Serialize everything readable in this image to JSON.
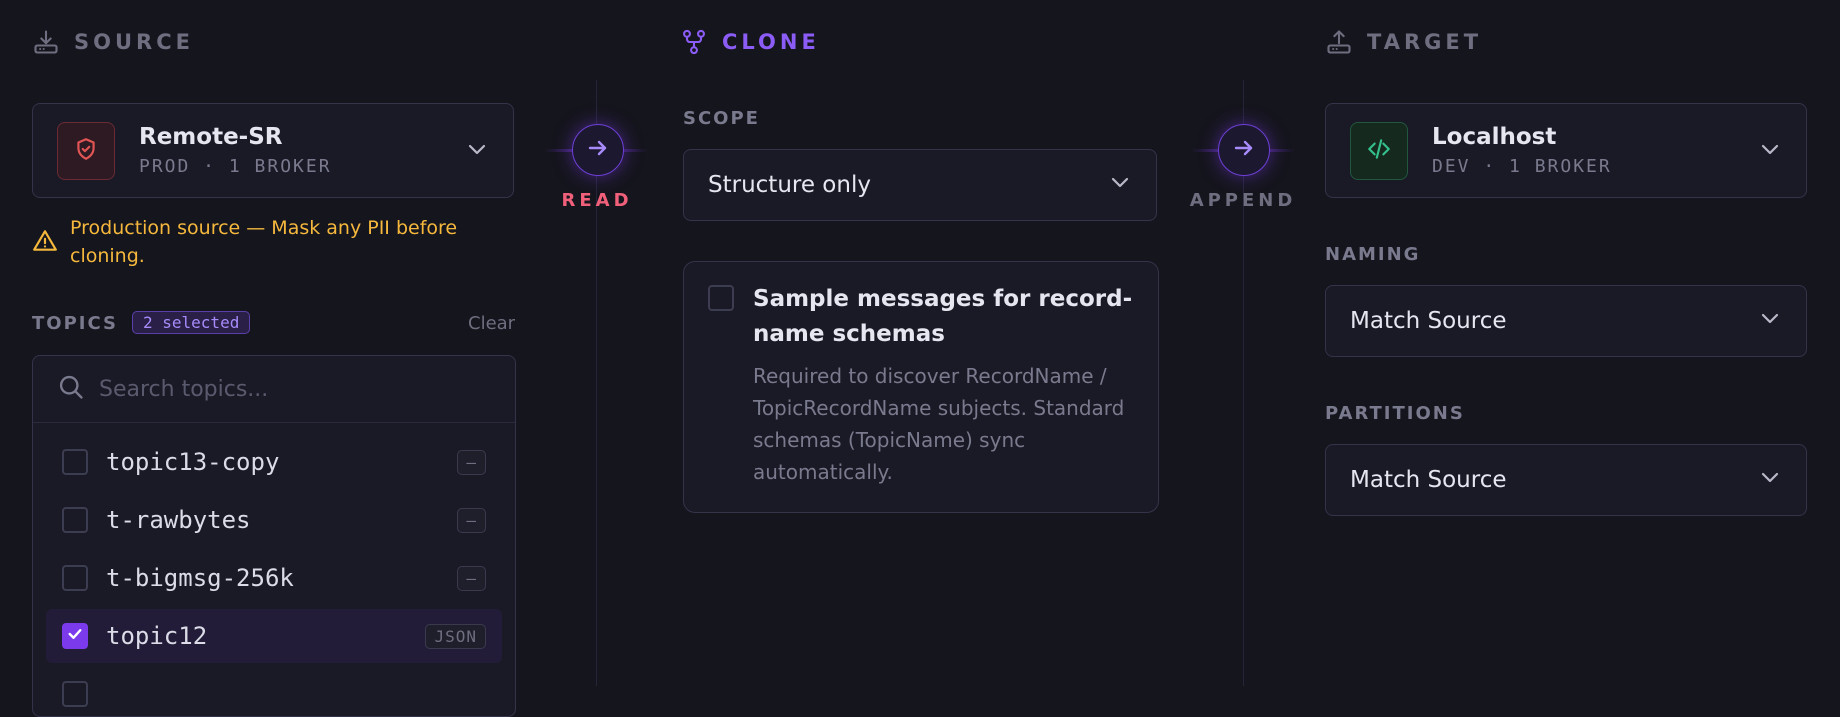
{
  "source": {
    "title": "SOURCE",
    "selected": {
      "name": "Remote-SR",
      "meta": "PROD · 1 BROKER"
    },
    "warning": "Production source — Mask any PII before cloning.",
    "topics_label": "TOPICS",
    "selected_badge": "2 selected",
    "clear_label": "Clear",
    "search_placeholder": "Search topics...",
    "topics": [
      {
        "name": "topic13-copy",
        "format": "—",
        "checked": false
      },
      {
        "name": "t-rawbytes",
        "format": "—",
        "checked": false
      },
      {
        "name": "t-bigmsg-256k",
        "format": "—",
        "checked": false
      },
      {
        "name": "topic12",
        "format": "JSON",
        "checked": true
      }
    ]
  },
  "read_label": "READ",
  "clone": {
    "title": "CLONE",
    "scope_label": "SCOPE",
    "scope_value": "Structure only",
    "option": {
      "title": "Sample messages for record-name schemas",
      "description": "Required to discover RecordName / TopicRecordName subjects. Standard schemas (TopicName) sync automatically."
    }
  },
  "append_label": "APPEND",
  "target": {
    "title": "TARGET",
    "selected": {
      "name": "Localhost",
      "meta": "DEV · 1 BROKER"
    },
    "naming_label": "NAMING",
    "naming_value": "Match Source",
    "partitions_label": "PARTITIONS",
    "partitions_value": "Match Source"
  },
  "colors": {
    "accent": "#8b5cf6",
    "warning": "#f5b83d",
    "read": "#f0607a",
    "prod_badge": "#e25555",
    "dev_badge": "#34c08a"
  }
}
